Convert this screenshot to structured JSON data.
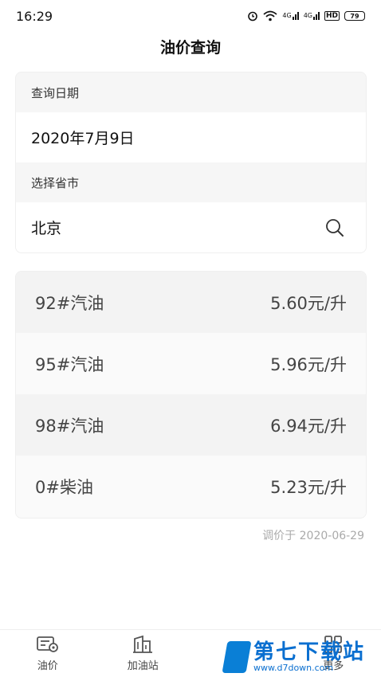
{
  "status_bar": {
    "time": "16:29",
    "signal_1": "4G",
    "signal_2": "4G",
    "hd": "HD",
    "battery": "79"
  },
  "header": {
    "title": "油价查询"
  },
  "query": {
    "date_label": "查询日期",
    "date_value": "2020年7月9日",
    "region_label": "选择省市",
    "region_value": "北京"
  },
  "prices": [
    {
      "name": "92#汽油",
      "price": "5.60元/升"
    },
    {
      "name": "95#汽油",
      "price": "5.96元/升"
    },
    {
      "name": "98#汽油",
      "price": "6.94元/升"
    },
    {
      "name": "0#柴油",
      "price": "5.23元/升"
    }
  ],
  "adjust_note": "调价于 2020-06-29",
  "nav": {
    "items": [
      {
        "label": "油价",
        "icon": "fuel-price-icon"
      },
      {
        "label": "加油站",
        "icon": "building-icon"
      },
      {
        "label": "",
        "icon": "green-circle-icon"
      },
      {
        "label": "更多",
        "icon": "grid-icon"
      }
    ],
    "accent": "#2db34a"
  },
  "watermark": {
    "title": "第七下载站",
    "url": "www.d7down.com"
  }
}
